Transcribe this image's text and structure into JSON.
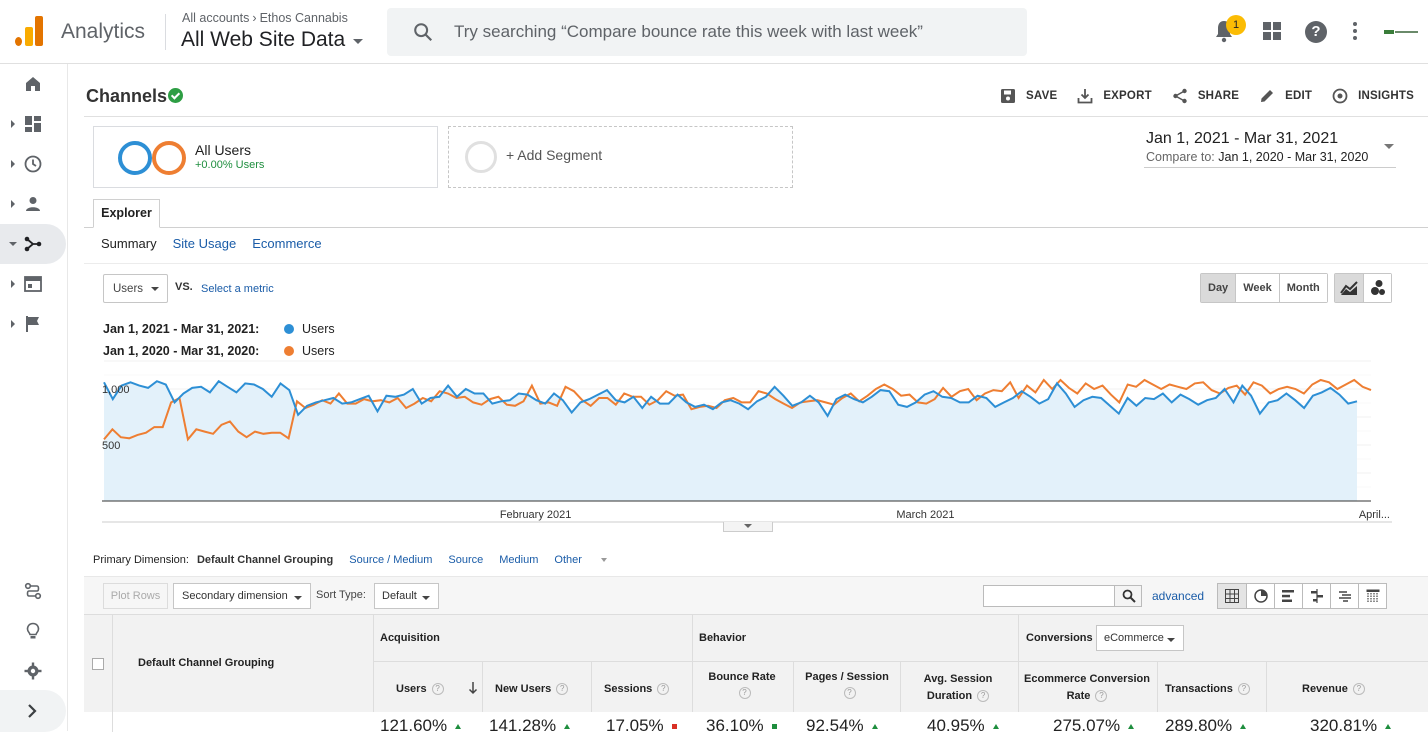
{
  "header": {
    "app_name": "Analytics",
    "breadcrumb_accounts": "All accounts",
    "breadcrumb_property": "Ethos Cannabis",
    "view_name": "All Web Site Data",
    "search_placeholder": "Try searching “Compare bounce rate this week with last week”",
    "notification_count": "1",
    "help_glyph": "?"
  },
  "nav": {
    "items": [
      "home-icon",
      "customization-icon",
      "realtime-icon",
      "audience-icon",
      "acquisition-icon",
      "behavior-icon",
      "conversions-icon"
    ],
    "active": "acquisition-icon",
    "bottom": [
      "attribution-icon",
      "discover-icon",
      "admin-icon"
    ]
  },
  "page": {
    "title": "Channels",
    "actions": [
      "SAVE",
      "EXPORT",
      "SHARE",
      "EDIT",
      "INSIGHTS"
    ]
  },
  "segments": {
    "active_name": "All Users",
    "active_sub": "+0.00% Users",
    "add_label": "+ Add Segment"
  },
  "date_range": {
    "main": "Jan 1, 2021 - Mar 31, 2021",
    "compare_label": "Compare to:",
    "compare_range": "Jan 1, 2020 - Mar 31, 2020"
  },
  "explorer": {
    "tab": "Explorer",
    "subtabs": [
      "Summary",
      "Site Usage",
      "Ecommerce"
    ],
    "metric": "Users",
    "vs": "VS.",
    "select_metric": "Select a metric",
    "granularity": [
      "Day",
      "Week",
      "Month"
    ],
    "granularity_active": "Day"
  },
  "legend": [
    {
      "range": "Jan 1, 2021 - Mar 31, 2021:",
      "metric": "Users",
      "color": "#2d8fd5"
    },
    {
      "range": "Jan 1, 2020 - Mar 31, 2020:",
      "metric": "Users",
      "color": "#ee7e32"
    }
  ],
  "chart_data": {
    "type": "line",
    "x_start": "2021-01-01",
    "x_ticks": [
      "February 2021",
      "March 2021",
      "April..."
    ],
    "y_ticks": [
      "1,000",
      "500"
    ],
    "ylim": [
      0,
      1250
    ],
    "grid": true,
    "series": [
      {
        "name": "Users",
        "period": "Jan 1, 2021 - Mar 31, 2021",
        "color": "#2d8fd5",
        "fill": "#e3f1fa",
        "values": [
          1060,
          910,
          1030,
          1060,
          1030,
          1010,
          1070,
          1040,
          880,
          960,
          1010,
          1020,
          970,
          1070,
          1020,
          970,
          1050,
          1040,
          1000,
          930,
          1050,
          990,
          770,
          850,
          880,
          900,
          920,
          870,
          880,
          910,
          940,
          800,
          940,
          930,
          950,
          1000,
          870,
          920,
          930,
          1030,
          930,
          1000,
          960,
          960,
          870,
          890,
          900,
          960,
          950,
          900,
          870,
          960,
          900,
          790,
          880,
          910,
          950,
          990,
          900,
          880,
          930,
          830,
          930,
          870,
          870,
          950,
          880,
          840,
          860,
          820,
          880,
          900,
          870,
          820,
          890,
          930,
          1020,
          940,
          850,
          880,
          940,
          880,
          760,
          910,
          950,
          910,
          880,
          930,
          990,
          980,
          860,
          840,
          880,
          950,
          980,
          930,
          920,
          880,
          880,
          940,
          920,
          840,
          880,
          920,
          980,
          930,
          870,
          910,
          1050,
          960,
          840,
          900,
          930,
          920,
          850,
          780,
          920,
          850,
          920,
          910,
          960,
          880,
          950,
          910,
          860,
          900,
          920,
          1000,
          880,
          1030,
          940,
          780,
          880,
          900,
          960,
          900,
          830,
          940,
          970,
          1010,
          950,
          870,
          890
        ]
      },
      {
        "name": "Users",
        "period": "Jan 1, 2020 - Mar 31, 2020",
        "color": "#ee7e32",
        "values": [
          550,
          640,
          570,
          560,
          590,
          610,
          660,
          660,
          880,
          920,
          550,
          640,
          620,
          600,
          680,
          710,
          620,
          570,
          620,
          600,
          610,
          610,
          560,
          890,
          830,
          860,
          900,
          870,
          960,
          870,
          870,
          910,
          890,
          900,
          880,
          920,
          830,
          870,
          920,
          890,
          980,
          960,
          920,
          930,
          880,
          860,
          910,
          930,
          860,
          850,
          890,
          1030,
          870,
          880,
          850,
          1020,
          980,
          900,
          850,
          920,
          920,
          860,
          960,
          930,
          930,
          860,
          900,
          980,
          940,
          950,
          820,
          840,
          850,
          830,
          900,
          920,
          880,
          880,
          980,
          960,
          910,
          870,
          830,
          880,
          890,
          900,
          880,
          860,
          920,
          960,
          890,
          940,
          1000,
          1040,
          1000,
          940,
          950,
          880,
          870,
          910,
          1010,
          930,
          980,
          1000,
          900,
          960,
          990,
          980,
          1060,
          920,
          1030,
          970,
          1080,
          1000,
          1080,
          1010,
          960,
          1050,
          1000,
          1030,
          950,
          880,
          1040,
          1020,
          1080,
          1040,
          1000,
          1040,
          1020,
          1000,
          1050,
          1060,
          990,
          960,
          1010,
          1030,
          950,
          1060,
          1030,
          960,
          1000,
          1020,
          1000,
          960,
          1040,
          1080,
          1060,
          1000,
          1040,
          1080,
          1020,
          990
        ]
      }
    ]
  },
  "table": {
    "primary_dim_label": "Primary Dimension:",
    "primary_dims": [
      "Default Channel Grouping",
      "Source / Medium",
      "Source",
      "Medium",
      "Other"
    ],
    "plot_rows": "Plot Rows",
    "secondary_dim": "Secondary dimension",
    "sort_label": "Sort Type:",
    "sort_value": "Default",
    "advanced": "advanced",
    "dim_header": "Default Channel Grouping",
    "groups": {
      "acquisition": "Acquisition",
      "behavior": "Behavior",
      "conversions": "Conversions",
      "conv_select": "eCommerce"
    },
    "columns": [
      "Users",
      "New Users",
      "Sessions",
      "Bounce Rate",
      "Pages / Session",
      "Avg. Session Duration",
      "Ecommerce Conversion Rate",
      "Transactions",
      "Revenue"
    ],
    "totals": [
      "121.60%",
      "141.28%",
      "17.05%",
      "36.10%",
      "92.54%",
      "40.95%",
      "275.07%",
      "289.80%",
      "320.81%"
    ]
  }
}
